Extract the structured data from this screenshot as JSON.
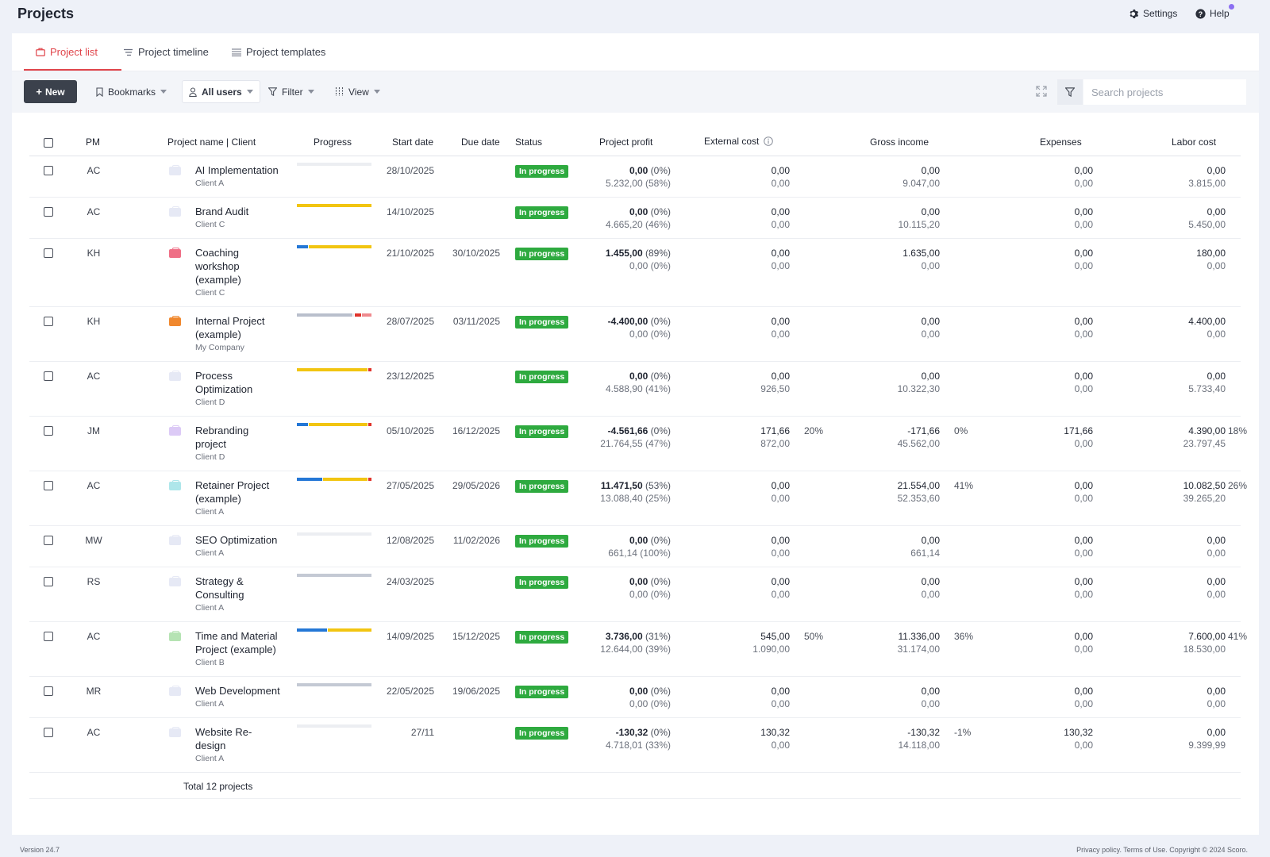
{
  "header": {
    "title": "Projects",
    "settings_label": "Settings",
    "help_label": "Help"
  },
  "tabs": [
    {
      "label": "Project list",
      "active": true
    },
    {
      "label": "Project timeline",
      "active": false
    },
    {
      "label": "Project templates",
      "active": false
    }
  ],
  "toolbar": {
    "new_label": "New",
    "bookmarks_label": "Bookmarks",
    "users_label": "All users",
    "filter_label": "Filter",
    "view_label": "View",
    "search_placeholder": "Search projects"
  },
  "columns": {
    "pm": "PM",
    "name": "Project name | Client",
    "progress": "Progress",
    "start": "Start date",
    "due": "Due date",
    "status": "Status",
    "profit": "Project profit",
    "external": "External cost",
    "gross": "Gross income",
    "expenses": "Expenses",
    "labor": "Labor cost"
  },
  "colors": {
    "accent": "#e0454b",
    "status_green": "#2eaa3f",
    "progress_blue": "#2477d6",
    "progress_yellow": "#f2c511",
    "progress_red": "#e0332b",
    "progress_grey": "#c4c9d4"
  },
  "rows": [
    {
      "pm": "AC",
      "name": [
        "AI Implementation"
      ],
      "client": "Client A",
      "icon_color": "#e6e9f5",
      "progress": [
        {
          "c": "#eceef2",
          "w": 94
        }
      ],
      "start": "28/10/2025",
      "due": "",
      "status": "In progress",
      "profit": "0,00",
      "profit_pct": "(0%)",
      "profit2": "5.232,00 (58%)",
      "ext": "0,00",
      "ext2": "0,00",
      "ext_pct": "",
      "gross": "0,00",
      "gross2": "9.047,00",
      "gross_pct": "",
      "exp": "0,00",
      "exp2": "0,00",
      "labor": "0,00",
      "labor2": "3.815,00",
      "labor_pct": ""
    },
    {
      "pm": "AC",
      "name": [
        "Brand Audit"
      ],
      "client": "Client C",
      "icon_color": "#e6e9f5",
      "progress": [
        {
          "c": "#f2c511",
          "w": 94
        }
      ],
      "start": "14/10/2025",
      "due": "",
      "status": "In progress",
      "profit": "0,00",
      "profit_pct": "(0%)",
      "profit2": "4.665,20 (46%)",
      "ext": "0,00",
      "ext2": "0,00",
      "ext_pct": "",
      "gross": "0,00",
      "gross2": "10.115,20",
      "gross_pct": "",
      "exp": "0,00",
      "exp2": "0,00",
      "labor": "0,00",
      "labor2": "5.450,00",
      "labor_pct": ""
    },
    {
      "pm": "KH",
      "name": [
        "Coaching",
        "workshop",
        "(example)"
      ],
      "client": "Client C",
      "icon_color": "#ef6f86",
      "progress": [
        {
          "c": "#2477d6",
          "w": 14
        },
        {
          "c": "#f2c511",
          "w": 79
        }
      ],
      "start": "21/10/2025",
      "due": "30/10/2025",
      "status": "In progress",
      "profit": "1.455,00",
      "profit_pct": "(89%)",
      "profit2": "0,00 (0%)",
      "ext": "0,00",
      "ext2": "0,00",
      "ext_pct": "",
      "gross": "1.635,00",
      "gross2": "0,00",
      "gross_pct": "",
      "exp": "0,00",
      "exp2": "0,00",
      "labor": "180,00",
      "labor2": "0,00",
      "labor_pct": ""
    },
    {
      "pm": "KH",
      "name": [
        "Internal Project",
        "(example)"
      ],
      "client": "My Company",
      "icon_color": "#f0882e",
      "progress": [
        {
          "c": "#b9bfcc",
          "w": 70
        },
        {
          "c": "#e8e9ee",
          "w": 1
        },
        {
          "c": "#e0332b",
          "w": 8
        },
        {
          "c": "#ef8a8e",
          "w": 12
        }
      ],
      "start": "28/07/2025",
      "due": "03/11/2025",
      "status": "In progress",
      "profit": "-4.400,00",
      "profit_pct": "(0%)",
      "profit2": "0,00 (0%)",
      "ext": "0,00",
      "ext2": "0,00",
      "ext_pct": "",
      "gross": "0,00",
      "gross2": "0,00",
      "gross_pct": "",
      "exp": "0,00",
      "exp2": "0,00",
      "labor": "4.400,00",
      "labor2": "0,00",
      "labor_pct": ""
    },
    {
      "pm": "AC",
      "name": [
        "Process",
        "Optimization"
      ],
      "client": "Client D",
      "icon_color": "#e6e9f5",
      "progress": [
        {
          "c": "#f2c511",
          "w": 89
        },
        {
          "c": "#e0332b",
          "w": 4
        }
      ],
      "start": "23/12/2025",
      "due": "",
      "status": "In progress",
      "profit": "0,00",
      "profit_pct": "(0%)",
      "profit2": "4.588,90 (41%)",
      "ext": "0,00",
      "ext2": "926,50",
      "ext_pct": "",
      "gross": "0,00",
      "gross2": "10.322,30",
      "gross_pct": "",
      "exp": "0,00",
      "exp2": "0,00",
      "labor": "0,00",
      "labor2": "5.733,40",
      "labor_pct": ""
    },
    {
      "pm": "JM",
      "name": [
        "Rebranding",
        "project"
      ],
      "client": "Client D",
      "icon_color": "#dccaf6",
      "progress": [
        {
          "c": "#2477d6",
          "w": 14
        },
        {
          "c": "#f2c511",
          "w": 75
        },
        {
          "c": "#e0332b",
          "w": 4
        }
      ],
      "start": "05/10/2025",
      "due": "16/12/2025",
      "status": "In progress",
      "profit": "-4.561,66",
      "profit_pct": "(0%)",
      "profit2": "21.764,55 (47%)",
      "ext": "171,66",
      "ext2": "872,00",
      "ext_pct": "20%",
      "gross": "-171,66",
      "gross2": "45.562,00",
      "gross_pct": "0%",
      "exp": "171,66",
      "exp2": "0,00",
      "labor": "4.390,00",
      "labor2": "23.797,45",
      "labor_pct": "18%"
    },
    {
      "pm": "AC",
      "name": [
        "Retainer Project",
        "(example)"
      ],
      "client": "Client A",
      "icon_color": "#aee6ea",
      "progress": [
        {
          "c": "#2477d6",
          "w": 32
        },
        {
          "c": "#f2c511",
          "w": 56
        },
        {
          "c": "#e0332b",
          "w": 4
        }
      ],
      "start": "27/05/2025",
      "due": "29/05/2026",
      "status": "In progress",
      "profit": "11.471,50",
      "profit_pct": "(53%)",
      "profit2": "13.088,40 (25%)",
      "ext": "0,00",
      "ext2": "0,00",
      "ext_pct": "",
      "gross": "21.554,00",
      "gross2": "52.353,60",
      "gross_pct": "41%",
      "exp": "0,00",
      "exp2": "0,00",
      "labor": "10.082,50",
      "labor2": "39.265,20",
      "labor_pct": "26%"
    },
    {
      "pm": "MW",
      "name": [
        "SEO Optimization"
      ],
      "client": "Client A",
      "icon_color": "#e6e9f5",
      "progress": [
        {
          "c": "#eceef2",
          "w": 94
        }
      ],
      "start": "12/08/2025",
      "due": "11/02/2026",
      "status": "In progress",
      "profit": "0,00",
      "profit_pct": "(0%)",
      "profit2": "661,14 (100%)",
      "ext": "0,00",
      "ext2": "0,00",
      "ext_pct": "",
      "gross": "0,00",
      "gross2": "661,14",
      "gross_pct": "",
      "exp": "0,00",
      "exp2": "0,00",
      "labor": "0,00",
      "labor2": "0,00",
      "labor_pct": ""
    },
    {
      "pm": "RS",
      "name": [
        "Strategy &",
        "Consulting"
      ],
      "client": "Client A",
      "icon_color": "#e6e9f5",
      "progress": [
        {
          "c": "#c4c9d4",
          "w": 94
        }
      ],
      "start": "24/03/2025",
      "due": "",
      "status": "In progress",
      "profit": "0,00",
      "profit_pct": "(0%)",
      "profit2": "0,00 (0%)",
      "ext": "0,00",
      "ext2": "0,00",
      "ext_pct": "",
      "gross": "0,00",
      "gross2": "0,00",
      "gross_pct": "",
      "exp": "0,00",
      "exp2": "0,00",
      "labor": "0,00",
      "labor2": "0,00",
      "labor_pct": ""
    },
    {
      "pm": "AC",
      "name": [
        "Time and Material",
        "Project (example)"
      ],
      "client": "Client B",
      "icon_color": "#b5e3b3",
      "progress": [
        {
          "c": "#2477d6",
          "w": 38
        },
        {
          "c": "#f2c511",
          "w": 55
        }
      ],
      "start": "14/09/2025",
      "due": "15/12/2025",
      "status": "In progress",
      "profit": "3.736,00",
      "profit_pct": "(31%)",
      "profit2": "12.644,00 (39%)",
      "ext": "545,00",
      "ext2": "1.090,00",
      "ext_pct": "50%",
      "gross": "11.336,00",
      "gross2": "31.174,00",
      "gross_pct": "36%",
      "exp": "0,00",
      "exp2": "0,00",
      "labor": "7.600,00",
      "labor2": "18.530,00",
      "labor_pct": "41%"
    },
    {
      "pm": "MR",
      "name": [
        "Web Development"
      ],
      "client": "Client A",
      "icon_color": "#e6e9f5",
      "progress": [
        {
          "c": "#c4c9d4",
          "w": 94
        }
      ],
      "start": "22/05/2025",
      "due": "19/06/2025",
      "status": "In progress",
      "profit": "0,00",
      "profit_pct": "(0%)",
      "profit2": "0,00 (0%)",
      "ext": "0,00",
      "ext2": "0,00",
      "ext_pct": "",
      "gross": "0,00",
      "gross2": "0,00",
      "gross_pct": "",
      "exp": "0,00",
      "exp2": "0,00",
      "labor": "0,00",
      "labor2": "0,00",
      "labor_pct": ""
    },
    {
      "pm": "AC",
      "name": [
        "Website Re-",
        "design"
      ],
      "client": "Client A",
      "icon_color": "#e6e9f5",
      "progress": [
        {
          "c": "#eceef2",
          "w": 94
        }
      ],
      "start": "27/11",
      "due": "",
      "status": "In progress",
      "profit": "-130,32",
      "profit_pct": "(0%)",
      "profit2": "4.718,01 (33%)",
      "ext": "130,32",
      "ext2": "0,00",
      "ext_pct": "",
      "gross": "-130,32",
      "gross2": "14.118,00",
      "gross_pct": "-1%",
      "exp": "130,32",
      "exp2": "0,00",
      "labor": "0,00",
      "labor2": "9.399,99",
      "labor_pct": ""
    }
  ],
  "total_label": "Total 12 projects",
  "footer": {
    "version": "Version 24.7",
    "legal": "Privacy policy. Terms of Use. Copyright © 2024 Scoro."
  }
}
